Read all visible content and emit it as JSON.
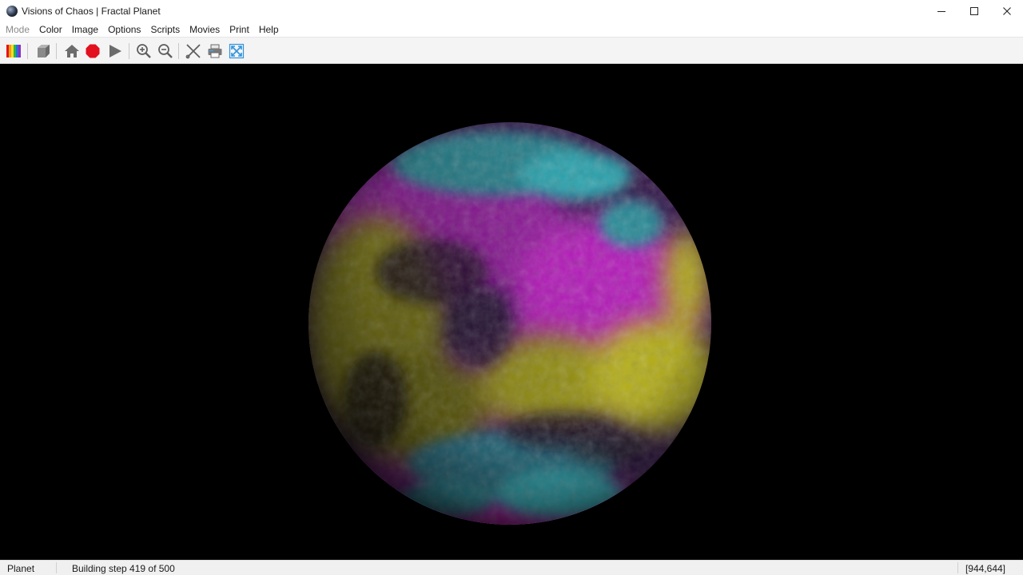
{
  "window": {
    "title": "Visions of Chaos | Fractal Planet",
    "controls": [
      "minimize-icon",
      "maximize-icon",
      "close-icon"
    ]
  },
  "menu": {
    "items": [
      {
        "label": "Mode",
        "enabled": false
      },
      {
        "label": "Color",
        "enabled": true
      },
      {
        "label": "Image",
        "enabled": true
      },
      {
        "label": "Options",
        "enabled": true
      },
      {
        "label": "Scripts",
        "enabled": true
      },
      {
        "label": "Movies",
        "enabled": true
      },
      {
        "label": "Print",
        "enabled": true
      },
      {
        "label": "Help",
        "enabled": true
      }
    ]
  },
  "toolbar": {
    "buttons": [
      "color-palette-icon",
      "cube-icon",
      "home-icon",
      "stop-icon",
      "play-icon",
      "zoom-in-icon",
      "zoom-out-icon",
      "cancel-tools-icon",
      "print-icon",
      "fullscreen-icon"
    ]
  },
  "status": {
    "mode": "Planet",
    "message": "Building step 419 of 500",
    "coordinates": "[944,644]"
  },
  "progress": {
    "current_step": 419,
    "total_steps": 500
  },
  "colors": {
    "canvas_background": "#000000",
    "planet_magenta": "#c21bc8",
    "planet_yellow": "#c9c21a",
    "planet_cyan": "#2fb3bf",
    "stop_button": "#e3101e"
  }
}
